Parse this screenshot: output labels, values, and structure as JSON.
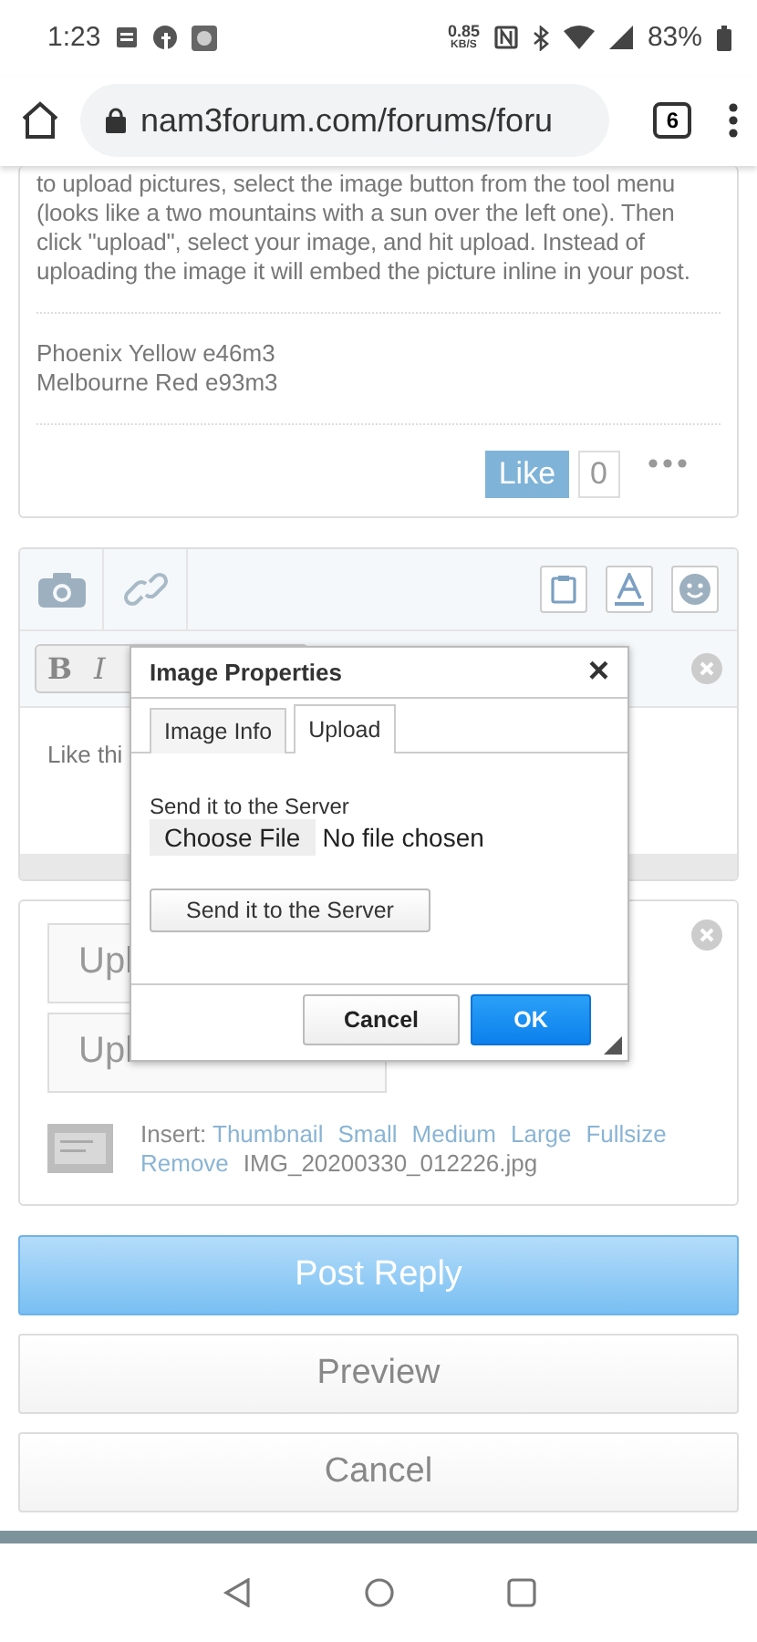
{
  "status_bar": {
    "time": "1:23",
    "net_speed": "0.85",
    "net_unit": "KB/S",
    "battery": "83%"
  },
  "browser": {
    "url": "nam3forum.com/forums/foru",
    "tab_count": "6"
  },
  "post": {
    "body": "to upload pictures, select the image button from the tool menu (looks like a two mountains with a sun over the left one). Then click \"upload\", select your image, and hit upload. Instead of uploading the image it will embed the picture inline in your post.",
    "signature": [
      "Phoenix Yellow e46m3",
      "Melbourne Red e93m3"
    ],
    "like_label": "Like",
    "like_count": "0"
  },
  "editor": {
    "format_buttons": [
      "B",
      "I"
    ],
    "text": "Like thi"
  },
  "attachments": {
    "upload_buttons": [
      "Upl",
      "Upl"
    ],
    "insert_label": "Insert:",
    "insert_links": [
      "Thumbnail",
      "Small",
      "Medium",
      "Large",
      "Fullsize"
    ],
    "remove_label": "Remove",
    "file_name": "IMG_20200330_012226.jpg"
  },
  "dialog": {
    "title": "Image Properties",
    "close": "×",
    "tabs": [
      {
        "label": "Image Info",
        "selected": false
      },
      {
        "label": "Upload",
        "selected": true
      }
    ],
    "field_label": "Send it to the Server",
    "choose_file": "Choose File",
    "file_status": "No file chosen",
    "send_button": "Send it to the Server",
    "cancel": "Cancel",
    "ok": "OK"
  },
  "actions": [
    {
      "label": "Post Reply",
      "kind": "primary"
    },
    {
      "label": "Preview",
      "kind": "secondary"
    },
    {
      "label": "Cancel",
      "kind": "secondary"
    }
  ]
}
